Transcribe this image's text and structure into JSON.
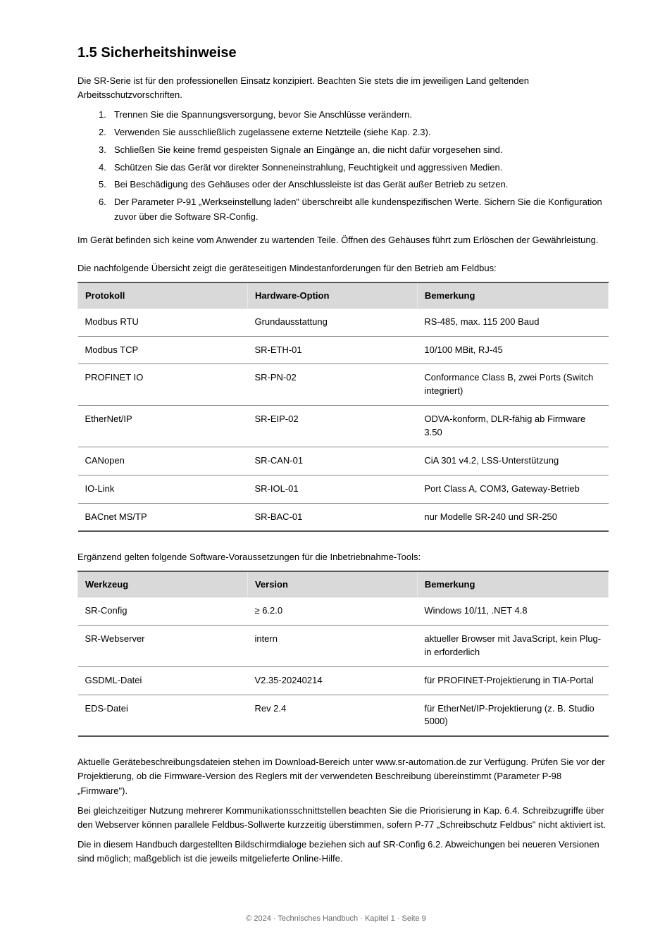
{
  "headings": {
    "section": "1.5  Sicherheitshinweise"
  },
  "intro": {
    "p1": "Die SR-Serie ist für den professionellen Einsatz konzipiert. Beachten Sie stets die im jeweiligen Land geltenden Arbeitsschutzvorschriften.",
    "list": [
      {
        "num": "1.",
        "text": "Trennen Sie die Spannungsversorgung, bevor Sie Anschlüsse verändern."
      },
      {
        "num": "2.",
        "text": "Verwenden Sie ausschließlich zugelassene externe Netzteile (siehe Kap. 2.3)."
      },
      {
        "num": "3.",
        "text": "Schließen Sie keine fremd gespeisten Signale an Eingänge an, die nicht dafür vorgesehen sind."
      },
      {
        "num": "4.",
        "text": "Schützen Sie das Gerät vor direkter Sonneneinstrahlung, Feuchtigkeit und aggressiven Medien."
      },
      {
        "num": "5.",
        "text": "Bei Beschädigung des Gehäuses oder der Anschlussleiste ist das Gerät außer Betrieb zu setzen."
      },
      {
        "num": "6.",
        "text": "Der Parameter P-91 „Werkseinstellung laden\" überschreibt alle kundenspezifischen Werte. Sichern Sie die Konfiguration zuvor über die Software SR-Config."
      }
    ],
    "p2": "Im Gerät befinden sich keine vom Anwender zu wartenden Teile. Öffnen des Gehäuses führt zum Erlöschen der Gewährleistung."
  },
  "table1": {
    "title": "Die nachfolgende Übersicht zeigt die geräteseitigen Mindestanforderungen für den Betrieb am Feldbus:",
    "headers": [
      "Protokoll",
      "Hardware-Option",
      "Bemerkung"
    ],
    "rows": [
      [
        "Modbus RTU",
        "Grundausstattung",
        "RS-485, max. 115 200 Baud"
      ],
      [
        "Modbus TCP",
        "SR-ETH-01",
        "10/100 MBit, RJ-45"
      ],
      [
        "PROFINET IO",
        "SR-PN-02",
        "Conformance Class B, zwei Ports (Switch integriert)"
      ],
      [
        "EtherNet/IP",
        "SR-EIP-02",
        "ODVA-konform, DLR-fähig ab Firmware 3.50"
      ],
      [
        "CANopen",
        "SR-CAN-01",
        "CiA 301 v4.2, LSS-Unterstützung"
      ],
      [
        "IO-Link",
        "SR-IOL-01",
        "Port Class A, COM3, Gateway-Betrieb"
      ],
      [
        "BACnet MS/TP",
        "SR-BAC-01",
        "nur Modelle SR-240 und SR-250"
      ]
    ]
  },
  "table2": {
    "title": "Ergänzend gelten folgende Software-Voraussetzungen für die Inbetriebnahme-Tools:",
    "headers": [
      "Werkzeug",
      "Version",
      "Bemerkung"
    ],
    "rows": [
      [
        "SR-Config",
        "≥ 6.2.0",
        "Windows 10/11, .NET 4.8"
      ],
      [
        "SR-Webserver",
        "intern",
        "aktueller Browser mit JavaScript, kein Plug-in erforderlich"
      ],
      [
        "GSDML-Datei",
        "V2.35-20240214",
        "für PROFINET-Projektierung in TIA-Portal"
      ],
      [
        "EDS-Datei",
        "Rev 2.4",
        "für EtherNet/IP-Projektierung (z. B. Studio 5000)"
      ]
    ]
  },
  "closing": {
    "p1": "Aktuelle Gerätebeschreibungsdateien stehen im Download-Bereich unter www.sr-automation.de zur Verfügung. Prüfen Sie vor der Projektierung, ob die Firmware-Version des Reglers mit der verwendeten Beschreibung übereinstimmt (Parameter P-98 „Firmware\").",
    "p2": "Bei gleichzeitiger Nutzung mehrerer Kommunikationsschnittstellen beachten Sie die Priorisierung in Kap. 6.4. Schreibzugriffe über den Webserver können parallele Feldbus-Sollwerte kurzzeitig überstimmen, sofern P-77 „Schreibschutz Feldbus\" nicht aktiviert ist.",
    "p3": "Die in diesem Handbuch dargestellten Bildschirmdialoge beziehen sich auf SR-Config 6.2. Abweichungen bei neueren Versionen sind möglich; maßgeblich ist die jeweils mitgelieferte Online-Hilfe."
  },
  "footer": "© 2024  ·  Technisches Handbuch  ·  Kapitel 1  ·  Seite 9"
}
